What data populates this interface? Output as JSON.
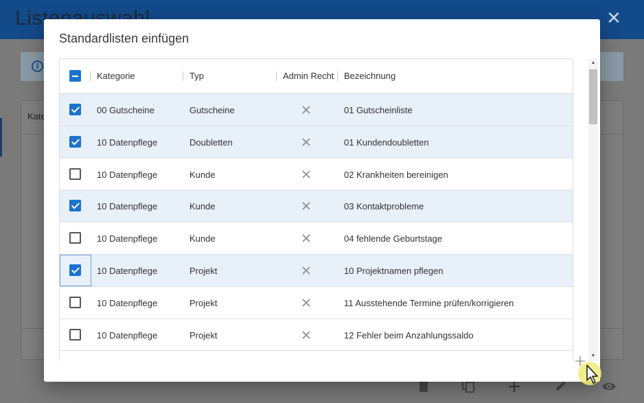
{
  "background": {
    "title": "Listenauswahl",
    "column_label": "Kate",
    "toolbar_icons": [
      "trash-icon",
      "copy-icon",
      "plus-icon",
      "pencil-icon",
      "eye-icon"
    ]
  },
  "dialog": {
    "title": "Standardlisten einfügen",
    "columns": {
      "select_all_state": "indeterminate",
      "kategorie": "Kategorie",
      "typ": "Typ",
      "admin": "Admin Recht",
      "bezeichnung": "Bezeichnung"
    },
    "rows": [
      {
        "checked": true,
        "kategorie": "00 Gutscheine",
        "typ": "Gutscheine",
        "admin": false,
        "bezeichnung": "01 Gutscheinliste"
      },
      {
        "checked": true,
        "kategorie": "10 Datenpflege",
        "typ": "Doubletten",
        "admin": false,
        "bezeichnung": "01 Kundendoubletten"
      },
      {
        "checked": false,
        "kategorie": "10 Datenpflege",
        "typ": "Kunde",
        "admin": false,
        "bezeichnung": "02 Krankheiten bereinigen"
      },
      {
        "checked": true,
        "kategorie": "10 Datenpflege",
        "typ": "Kunde",
        "admin": false,
        "bezeichnung": "03 Kontaktprobleme"
      },
      {
        "checked": false,
        "kategorie": "10 Datenpflege",
        "typ": "Kunde",
        "admin": false,
        "bezeichnung": "04 fehlende Geburtstage"
      },
      {
        "checked": true,
        "kategorie": "10 Datenpflege",
        "typ": "Projekt",
        "admin": false,
        "bezeichnung": "10 Projektnamen pflegen",
        "focused": true
      },
      {
        "checked": false,
        "kategorie": "10 Datenpflege",
        "typ": "Projekt",
        "admin": false,
        "bezeichnung": "11 Ausstehende Termine prüfen/korrigieren"
      },
      {
        "checked": false,
        "kategorie": "10 Datenpflege",
        "typ": "Projekt",
        "admin": false,
        "bezeichnung": "12 Fehler beim Anzahlungssaldo"
      }
    ],
    "add_icon": "plus-icon"
  },
  "colors": {
    "header": "#134a8a",
    "accent": "#1a73d1",
    "selected_row": "#e8f0fa"
  }
}
